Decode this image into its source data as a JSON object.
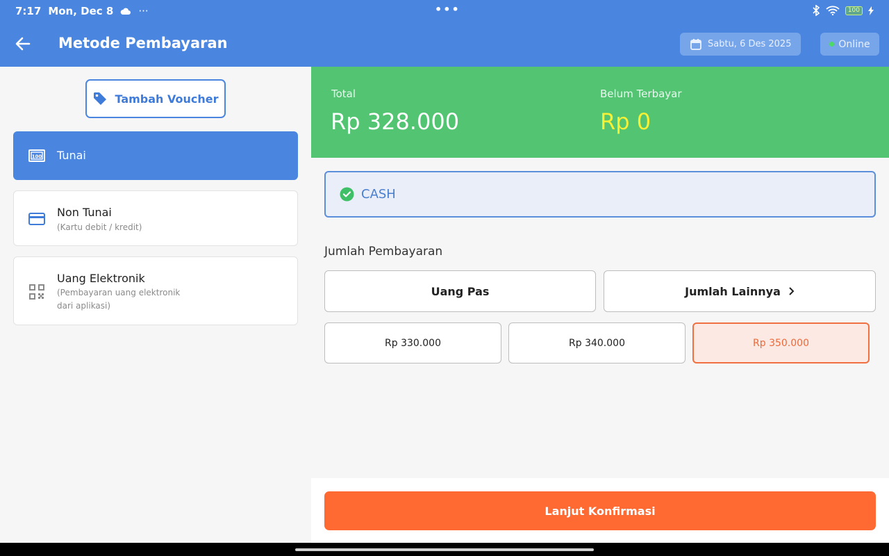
{
  "status_bar": {
    "time": "7:17",
    "date": "Mon, Dec 8",
    "more": "···",
    "center_dots": "•••",
    "battery": "100"
  },
  "app_bar": {
    "title": "Metode Pembayaran",
    "date_chip": "Sabtu, 6 Des 2025",
    "status": "Online"
  },
  "left_panel": {
    "voucher_button": "Tambah Voucher",
    "methods": [
      {
        "name": "Tunai",
        "sub": "",
        "icon": "cash-icon",
        "active": true
      },
      {
        "name": "Non Tunai",
        "sub": "(Kartu debit / kredit)",
        "icon": "credit-card-icon",
        "active": false
      },
      {
        "name": "Uang Elektronik",
        "sub": "(Pembayaran uang elektronik dari aplikasi)",
        "icon": "qr-code-icon",
        "active": false
      }
    ]
  },
  "summary": {
    "total_label": "Total",
    "total_value": "Rp 328.000",
    "unpaid_label": "Belum Terbayar",
    "unpaid_value": "Rp 0"
  },
  "selected_method": "CASH",
  "payment_amount": {
    "label": "Jumlah Pembayaran",
    "exact": "Uang Pas",
    "other": "Jumlah Lainnya",
    "quick_amounts": [
      {
        "label": "Rp 330.000",
        "selected": false
      },
      {
        "label": "Rp 340.000",
        "selected": false
      },
      {
        "label": "Rp 350.000",
        "selected": true
      }
    ]
  },
  "confirm_button": "Lanjut Konfirmasi",
  "colors": {
    "primary": "#4a86e0",
    "summary_bg": "#52c472",
    "unpaid_value": "#f7f035",
    "accent": "#ff6a33"
  }
}
